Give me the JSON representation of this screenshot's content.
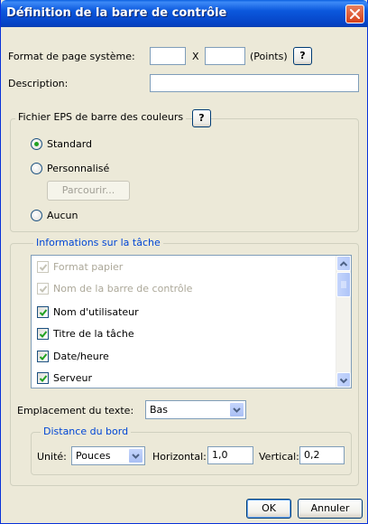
{
  "window": {
    "title": "Définition de la barre de contrôle"
  },
  "page_format": {
    "label": "Format de page système:",
    "width_value": "",
    "separator": "X",
    "height_value": "",
    "unit": "(Points)",
    "help_label": "?"
  },
  "description": {
    "label": "Description:",
    "value": ""
  },
  "eps_group": {
    "legend": "Fichier EPS de barre des couleurs",
    "help_label": "?",
    "options": [
      {
        "label": "Standard",
        "checked": true
      },
      {
        "label": "Personnalisé",
        "checked": false
      },
      {
        "label": "Aucun",
        "checked": false
      }
    ],
    "browse_label": "Parcourir..."
  },
  "task_group": {
    "legend": "Informations sur la tâche",
    "items": [
      {
        "label": "Format papier",
        "checked": true,
        "enabled": false
      },
      {
        "label": "Nom de la barre de contrôle",
        "checked": true,
        "enabled": false
      },
      {
        "label": "Nom d'utilisateur",
        "checked": true,
        "enabled": true
      },
      {
        "label": "Titre de la tâche",
        "checked": true,
        "enabled": true
      },
      {
        "label": "Date/heure",
        "checked": true,
        "enabled": true
      },
      {
        "label": "Serveur",
        "checked": true,
        "enabled": true
      }
    ],
    "text_position_label": "Emplacement du texte:",
    "text_position_value": "Bas"
  },
  "edge_group": {
    "legend": "Distance du bord",
    "unit_label": "Unité:",
    "unit_value": "Pouces",
    "horizontal_label": "Horizontal:",
    "horizontal_value": "1,0",
    "vertical_label": "Vertical:",
    "vertical_value": "0,2"
  },
  "footer": {
    "ok_label": "OK",
    "cancel_label": "Annuler"
  },
  "colors": {
    "titlebar": "#0054e3",
    "dialog_bg": "#ece9d8",
    "group_legend_blue": "#0046d5",
    "radio_dot": "#21a121",
    "check_mark": "#21a121"
  }
}
